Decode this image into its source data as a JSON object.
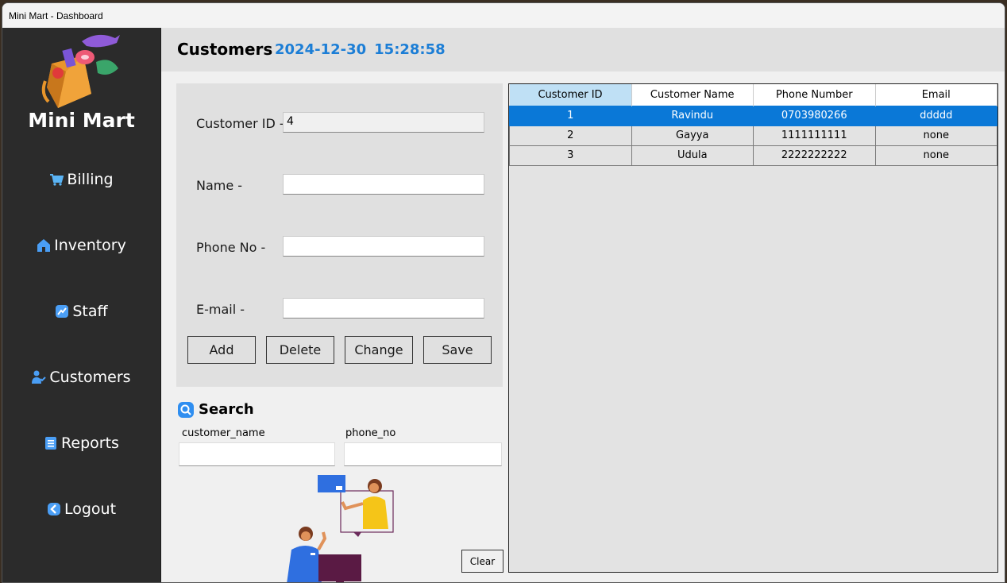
{
  "window": {
    "title": "Mini Mart - Dashboard"
  },
  "sidebar": {
    "brand": "Mini Mart",
    "items": [
      {
        "label": "Billing",
        "icon": "cart-icon"
      },
      {
        "label": "Inventory",
        "icon": "home-icon"
      },
      {
        "label": "Staff",
        "icon": "chart-icon"
      },
      {
        "label": "Customers",
        "icon": "user-check-icon"
      },
      {
        "label": "Reports",
        "icon": "report-icon"
      },
      {
        "label": "Logout",
        "icon": "back-arrow-icon"
      }
    ]
  },
  "header": {
    "title": "Customers",
    "date": "2024-12-30",
    "time": "15:28:58"
  },
  "form": {
    "customer_id_label": "Customer ID -",
    "customer_id_value": "4",
    "name_label": "Name -",
    "phone_label": "Phone No -",
    "email_label": "E-mail -",
    "buttons": {
      "add": "Add",
      "delete": "Delete",
      "change": "Change",
      "save": "Save"
    }
  },
  "search": {
    "title": "Search",
    "name_label": "customer_name",
    "phone_label": "phone_no",
    "clear": "Clear"
  },
  "table": {
    "columns": [
      "Customer ID",
      "Customer Name",
      "Phone Number",
      "Email"
    ],
    "rows": [
      [
        "1",
        "Ravindu",
        "0703980266",
        "ddddd"
      ],
      [
        "2",
        "Gayya",
        "1111111111",
        "none"
      ],
      [
        "3",
        "Udula",
        "2222222222",
        "none"
      ]
    ],
    "selected_row": 0
  },
  "colors": {
    "accent": "#0a78d7",
    "datetime": "#1c7ed6",
    "sidebar": "#2b2b2b"
  }
}
